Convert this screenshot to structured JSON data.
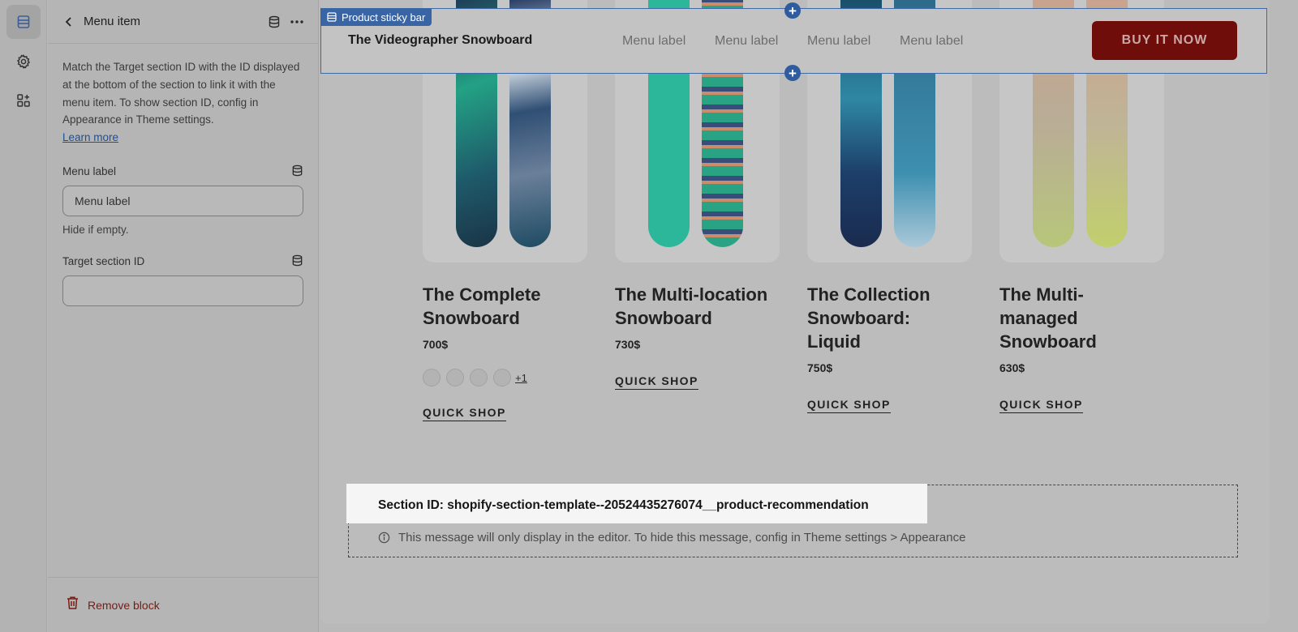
{
  "rail": {
    "items": [
      {
        "name": "sections",
        "icon": "sections-icon",
        "active": true
      },
      {
        "name": "settings",
        "icon": "gear-icon",
        "active": false
      },
      {
        "name": "apps",
        "icon": "apps-add-icon",
        "active": false
      }
    ]
  },
  "panel": {
    "title": "Menu item",
    "description": "Match the Target section ID with the ID displayed at the bottom of the section to link it with the menu item. To show section ID, config in Appearance in Theme settings.",
    "learn_more": "Learn more",
    "menu_label": {
      "label": "Menu label",
      "value": "Menu label",
      "hint": "Hide if empty."
    },
    "target_section": {
      "label": "Target section ID",
      "value": ""
    },
    "remove_label": "Remove block"
  },
  "sticky_bar": {
    "tag": "Product sticky bar",
    "product_title": "The Videographer Snowboard",
    "menu_labels": [
      "Menu label",
      "Menu label",
      "Menu label",
      "Menu label"
    ],
    "buy_label": "BUY IT NOW",
    "buy_color": "#6e0d09"
  },
  "products": [
    {
      "title": "The Complete Snowboard",
      "price": "700$",
      "swatches_more": "+1",
      "quick": "QUICK SHOP"
    },
    {
      "title": "The Multi-location Snowboard",
      "price": "730$",
      "quick": "QUICK SHOP"
    },
    {
      "title": "The Collection Snowboard: Liquid",
      "price": "750$",
      "quick": "QUICK SHOP"
    },
    {
      "title": "The Multi-managed Snowboard",
      "price": "630$",
      "quick": "QUICK SHOP"
    }
  ],
  "section_notice": {
    "section_id": "Section ID: shopify-section-template--20524435276074__product-recommendation",
    "message": "This message will only display in the editor. To hide this message, config in Theme settings > Appearance"
  }
}
